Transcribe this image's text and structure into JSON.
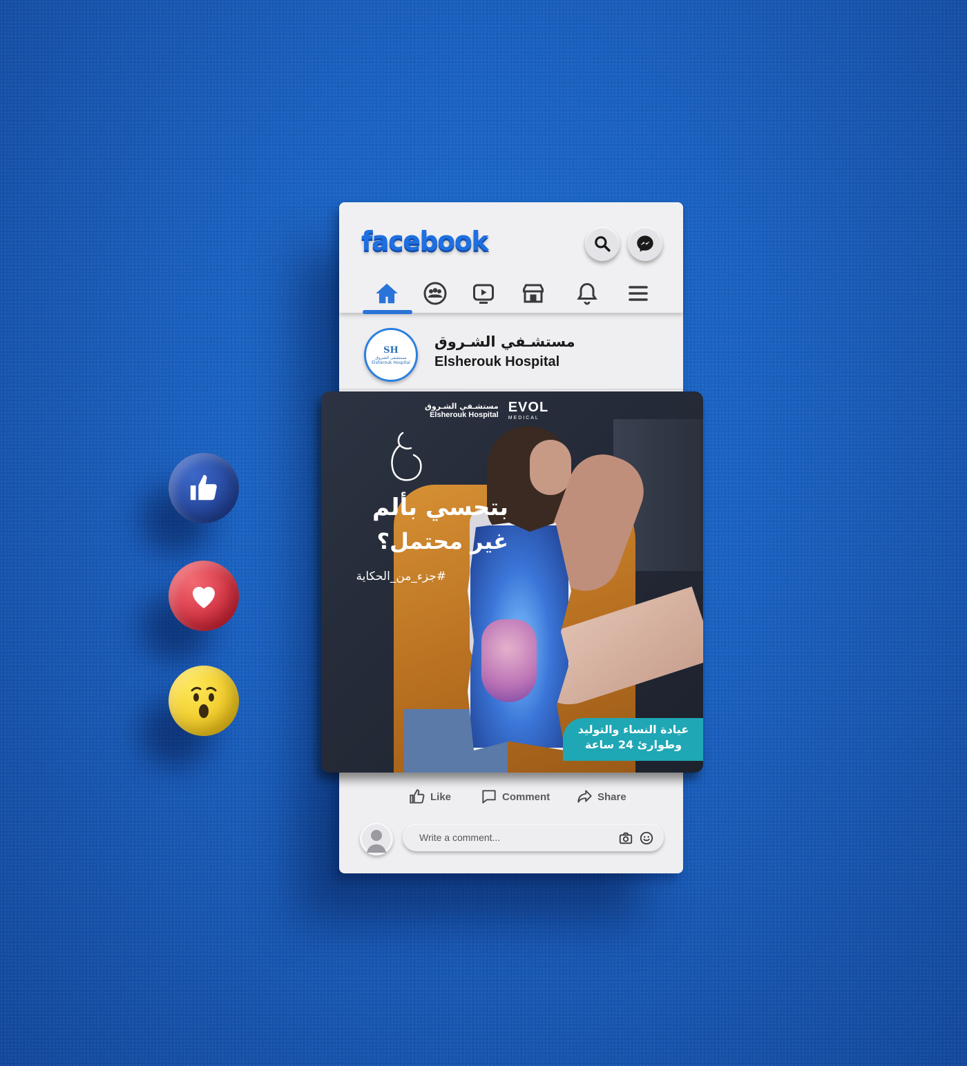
{
  "app": {
    "logo_text": "facebook"
  },
  "header": {
    "icons": [
      "search-icon",
      "messenger-icon"
    ],
    "nav": [
      {
        "name": "home",
        "icon": "home-icon",
        "active": true
      },
      {
        "name": "groups",
        "icon": "groups-icon",
        "active": false
      },
      {
        "name": "watch",
        "icon": "video-icon",
        "active": false
      },
      {
        "name": "marketplace",
        "icon": "store-icon",
        "active": false
      },
      {
        "name": "notifications",
        "icon": "bell-icon",
        "active": false
      },
      {
        "name": "menu",
        "icon": "menu-icon",
        "active": false
      }
    ]
  },
  "post": {
    "page_name_ar": "مستشـفي الشـروق",
    "page_name_en": "Elsherouk Hospital",
    "avatar": {
      "initials": "SH",
      "caption_ar": "مستشفى الشروق",
      "caption_en": "Elsherouk Hospital"
    },
    "image": {
      "hospital_ar": "مستشـفي الشـروق",
      "hospital_en": "Elsherouk Hospital",
      "partner": "EVOL",
      "partner_sub": "MEDICAL",
      "headline_line1": "بتحسي بألم",
      "headline_line2": "غير محتمل؟",
      "hashtag": "#جزء_من_الحكاية",
      "badge_line1": "عيادة النساء والتوليد",
      "badge_line2": "وطوارئ 24 ساعة"
    }
  },
  "actions": {
    "like": "Like",
    "comment": "Comment",
    "share": "Share"
  },
  "comment_box": {
    "placeholder": "Write a comment..."
  },
  "reactions": [
    "like-icon",
    "love-icon",
    "wow-icon"
  ],
  "colors": {
    "background": "#1a5fbe",
    "facebook_blue": "#1f6fe0",
    "badge": "#1fa7b5"
  }
}
